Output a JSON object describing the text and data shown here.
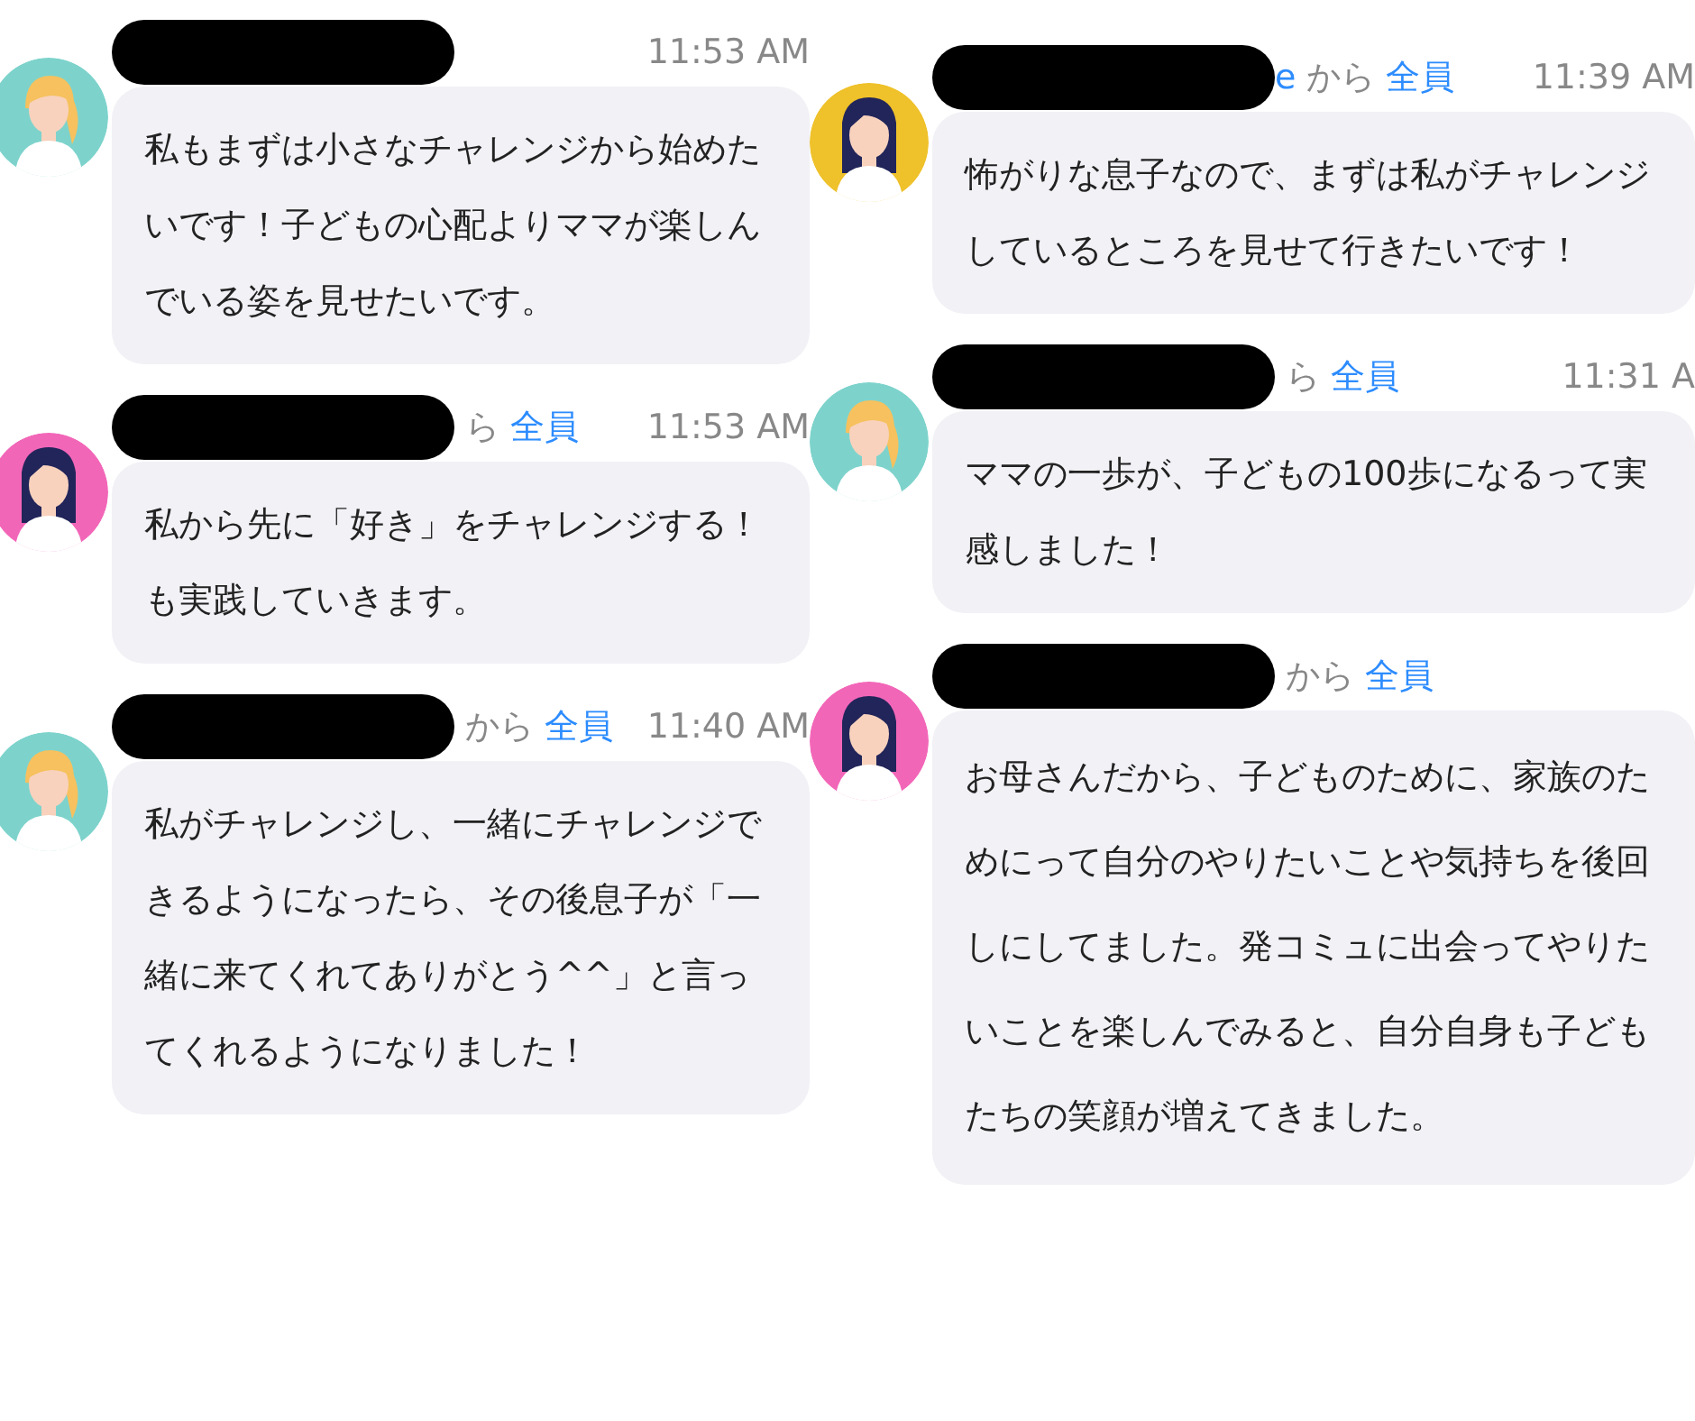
{
  "columns": [
    {
      "messages": [
        {
          "avatar": {
            "color": "#7dd3cc",
            "kind": "ponytail"
          },
          "header": {
            "name_redacted": true,
            "time": "11:53 AM"
          },
          "text": "私もまずは小さなチャレンジから始めたいです！子どもの心配よりママが楽しんでいる姿を見せたいです。"
        },
        {
          "avatar": {
            "color": "#f266b8",
            "kind": "long"
          },
          "header": {
            "name_redacted": true,
            "connector": "ら",
            "recipient": "全員",
            "time": "11:53 AM"
          },
          "text": "私から先に「好き」をチャレンジする！も実践していきます。"
        },
        {
          "avatar": {
            "color": "#7dd3cc",
            "kind": "ponytail"
          },
          "header": {
            "name_redacted": true,
            "connector": "から",
            "recipient": "全員",
            "time": "11:40 AM"
          },
          "text": "私がチャレンジし、一緒にチャレンジできるようになったら、その後息子が「一緒に来てくれてありがとう^^」と言ってくれるようになりました！"
        }
      ]
    },
    {
      "messages": [
        {
          "avatar": {
            "color": "#efc12a",
            "kind": "long"
          },
          "header": {
            "name_redacted": true,
            "sender": "e",
            "connector": "から",
            "recipient": "全員",
            "time": "11:39 AM"
          },
          "text": "怖がりな息子なので、まずは私がチャレンジしているところを見せて行きたいです！"
        },
        {
          "avatar": {
            "color": "#7dd3cc",
            "kind": "ponytail"
          },
          "header": {
            "name_redacted": true,
            "connector": "ら",
            "recipient": "全員",
            "time": "11:31 A"
          },
          "text": "ママの一歩が、子どもの100歩になるって実感しました！"
        },
        {
          "avatar": {
            "color": "#f266b8",
            "kind": "long"
          },
          "header": {
            "name_redacted": true,
            "connector": "から",
            "recipient": "全員"
          },
          "text": "お母さんだから、子どものために、家族のためにって自分のやりたいことや気持ちを後回しにしてました。発コミュに出会ってやりたいことを楽しんでみると、自分自身も子どもたちの笑顔が増えてきました。"
        }
      ]
    }
  ]
}
